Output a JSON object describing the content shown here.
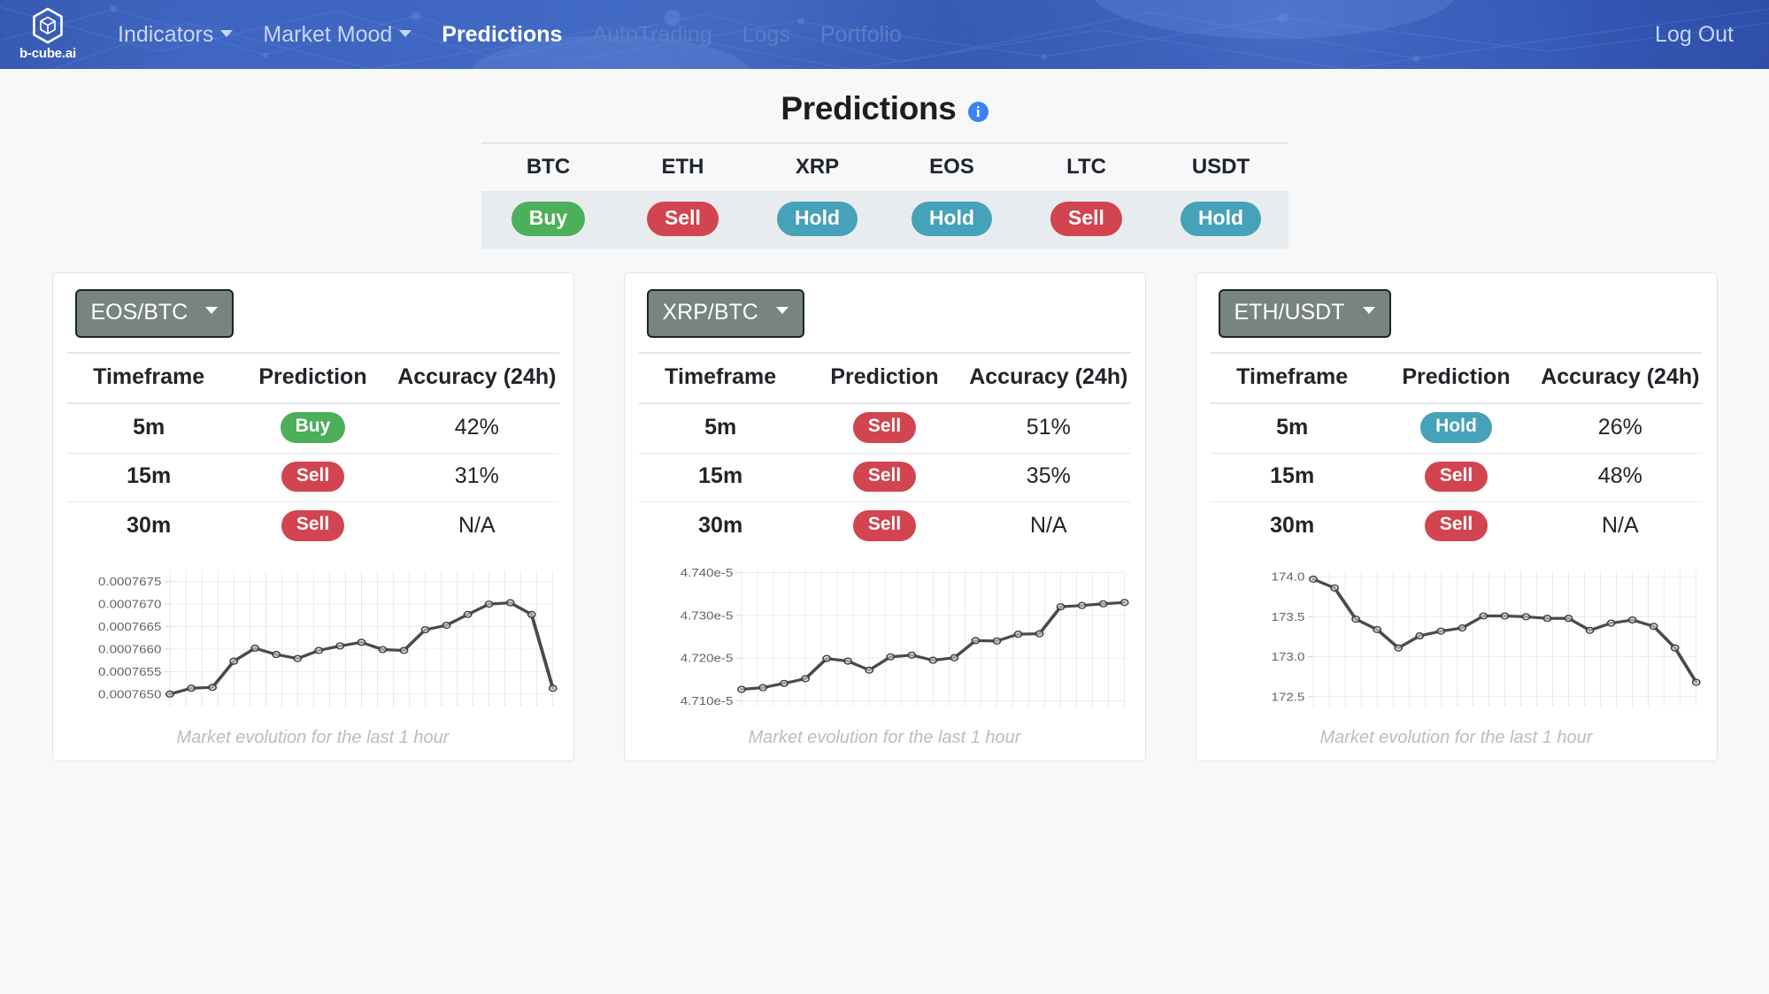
{
  "navbar": {
    "brand": {
      "name": "b-cube.ai",
      "logo_icon": "hexagon-cube-logo"
    },
    "items": [
      {
        "label": "Indicators",
        "has_caret": true,
        "state": "normal"
      },
      {
        "label": "Market Mood",
        "has_caret": true,
        "state": "normal"
      },
      {
        "label": "Predictions",
        "has_caret": false,
        "state": "active"
      },
      {
        "label": "AutoTrading",
        "has_caret": false,
        "state": "disabled"
      },
      {
        "label": "Logs",
        "has_caret": false,
        "state": "disabled"
      },
      {
        "label": "Portfolio",
        "has_caret": false,
        "state": "disabled"
      }
    ],
    "logout_label": "Log Out",
    "background_color": "#2a4ba8"
  },
  "page": {
    "title": "Predictions",
    "info_icon": "info-circle-icon",
    "background_color": "#f7f8fa"
  },
  "summary": {
    "assets": [
      "BTC",
      "ETH",
      "XRP",
      "EOS",
      "LTC",
      "USDT"
    ],
    "signals": [
      "Buy",
      "Sell",
      "Hold",
      "Hold",
      "Sell",
      "Hold"
    ]
  },
  "colors": {
    "buy": "#4caf5a",
    "sell": "#d2444f",
    "hold": "#46a2b8",
    "accent": "#3b82f6",
    "pair_button": "#78847e"
  },
  "table_headers": [
    "Timeframe",
    "Prediction",
    "Accuracy (24h)"
  ],
  "chart_caption": "Market evolution for the last 1 hour",
  "cards": [
    {
      "pair": "EOS/BTC",
      "caret_icon": "chevron-down-icon",
      "rows": [
        {
          "timeframe": "5m",
          "prediction": "Buy",
          "accuracy": "42%"
        },
        {
          "timeframe": "15m",
          "prediction": "Sell",
          "accuracy": "31%"
        },
        {
          "timeframe": "30m",
          "prediction": "Sell",
          "accuracy": "N/A"
        }
      ]
    },
    {
      "pair": "XRP/BTC",
      "caret_icon": "chevron-down-icon",
      "rows": [
        {
          "timeframe": "5m",
          "prediction": "Sell",
          "accuracy": "51%"
        },
        {
          "timeframe": "15m",
          "prediction": "Sell",
          "accuracy": "35%"
        },
        {
          "timeframe": "30m",
          "prediction": "Sell",
          "accuracy": "N/A"
        }
      ]
    },
    {
      "pair": "ETH/USDT",
      "caret_icon": "chevron-down-icon",
      "rows": [
        {
          "timeframe": "5m",
          "prediction": "Hold",
          "accuracy": "26%"
        },
        {
          "timeframe": "15m",
          "prediction": "Sell",
          "accuracy": "48%"
        },
        {
          "timeframe": "30m",
          "prediction": "Sell",
          "accuracy": "N/A"
        }
      ]
    }
  ],
  "chart_data": [
    {
      "type": "line",
      "title": "",
      "xlabel": "",
      "ylabel": "",
      "caption": "Market evolution for the last 1 hour",
      "pair": "EOS/BTC",
      "grid": true,
      "legend": "none",
      "ylim": [
        0.0007648,
        0.00076775
      ],
      "yticks": [
        0.000765,
        0.0007655,
        0.000766,
        0.0007665,
        0.000767,
        0.0007675
      ],
      "ytick_labels": [
        "0.0007650",
        "0.0007655",
        "0.0007660",
        "0.0007665",
        "0.0007670",
        "0.0007675"
      ],
      "x": [
        0,
        1,
        2,
        3,
        4,
        5,
        6,
        7,
        8,
        9,
        10,
        11,
        12,
        13,
        14,
        15,
        16,
        17,
        18,
        19,
        20,
        21,
        22
      ],
      "values": [
        0.000765,
        0.00076513,
        0.00076515,
        0.00076573,
        0.00076602,
        0.00076588,
        0.00076579,
        0.00076597,
        0.00076607,
        0.00076615,
        0.00076599,
        0.00076597,
        0.00076643,
        0.00076653,
        0.00076677,
        0.000767,
        0.00076703,
        0.00076677,
        0.00076513
      ]
    },
    {
      "type": "line",
      "title": "",
      "xlabel": "",
      "ylabel": "",
      "caption": "Market evolution for the last 1 hour",
      "pair": "XRP/BTC",
      "grid": true,
      "legend": "none",
      "ylim": [
        4.7095e-05,
        4.7405e-05
      ],
      "yticks": [
        4.71e-05,
        4.72e-05,
        4.73e-05,
        4.74e-05
      ],
      "ytick_labels": [
        "4.710e-5",
        "4.720e-5",
        "4.730e-5",
        "4.740e-5"
      ],
      "x": [
        0,
        1,
        2,
        3,
        4,
        5,
        6,
        7,
        8,
        9,
        10,
        11,
        12,
        13,
        14,
        15,
        16,
        17,
        18,
        19,
        20
      ],
      "values": [
        4.7127e-05,
        4.7131e-05,
        4.7141e-05,
        4.7152e-05,
        4.7199e-05,
        4.7193e-05,
        4.7172e-05,
        4.7203e-05,
        4.7207e-05,
        4.7195e-05,
        4.7201e-05,
        4.7241e-05,
        4.724e-05,
        4.7256e-05,
        4.7257e-05,
        4.732e-05,
        4.7323e-05,
        4.7327e-05,
        4.733e-05
      ]
    },
    {
      "type": "line",
      "title": "",
      "xlabel": "",
      "ylabel": "",
      "caption": "Market evolution for the last 1 hour",
      "pair": "ETH/USDT",
      "grid": true,
      "legend": "none",
      "ylim": [
        172.42,
        174.08
      ],
      "yticks": [
        172.5,
        173.0,
        173.5,
        174.0
      ],
      "ytick_labels": [
        "172.5",
        "173.0",
        "173.5",
        "174.0"
      ],
      "x": [
        0,
        1,
        2,
        3,
        4,
        5,
        6,
        7,
        8,
        9,
        10,
        11,
        12,
        13,
        14,
        15,
        16,
        17,
        18,
        19,
        20,
        21
      ],
      "values": [
        173.97,
        173.86,
        173.47,
        173.34,
        173.11,
        173.26,
        173.32,
        173.36,
        173.51,
        173.51,
        173.5,
        173.48,
        173.48,
        173.33,
        173.42,
        173.46,
        173.38,
        173.11,
        172.68
      ]
    }
  ]
}
